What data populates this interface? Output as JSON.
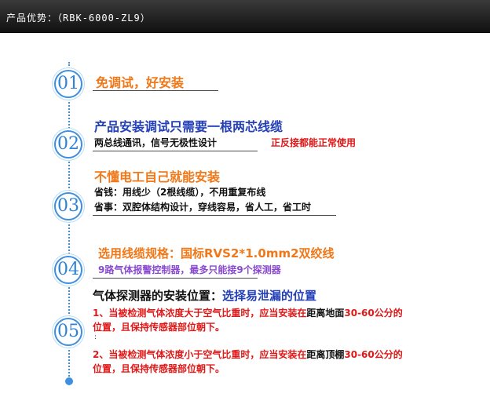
{
  "header": {
    "label": "产品优势：",
    "model": "（RBK-6000-ZL9）"
  },
  "steps": [
    {
      "number": "01"
    },
    {
      "number": "02"
    },
    {
      "number": "03"
    },
    {
      "number": "04"
    },
    {
      "number": "05"
    }
  ],
  "s1": {
    "title": "免调试，好安装"
  },
  "s2": {
    "title": "产品安装调试只需要一根两芯线缆",
    "line1": "两总线通讯，信号无极性设计",
    "line1_highlight": "正反接都能正常使用"
  },
  "s3": {
    "title": "不懂电工自己就能安装",
    "line1": "省钱：用线少（2根线缆），不用重复布线",
    "line2": "省事：双腔体结构设计，穿线容易，省人工，省工时"
  },
  "s4": {
    "title": "选用线缆规格：国标RVS2*1.0mm2双绞线",
    "sub": "9路气体报警控制器，最多只能接9个探测器"
  },
  "s5": {
    "title": "气体探测器的安装位置：",
    "title_highlight": "选择易泄漏的位置",
    "item1_a": "1、当被检测气体浓度大于空气比重时，应当安装在",
    "item1_b": "距离地面",
    "item1_c": "30-60公分的",
    "item1_d": "位置，且保持传感器部位朝下。",
    "mark": ":",
    "item2_a": "2、当被检测气体浓度小于空气比重时，应当安装在",
    "item2_b": "距离顶棚",
    "item2_c": "30-60公分的",
    "item2_d": "位置，且保持传感器部位朝下。"
  },
  "colors": {
    "accent_blue": "#3d8fe0",
    "title_orange": "#f07818",
    "title_blue": "#2440b8",
    "highlight_red": "#e01818",
    "purple": "#8a4ad0"
  }
}
